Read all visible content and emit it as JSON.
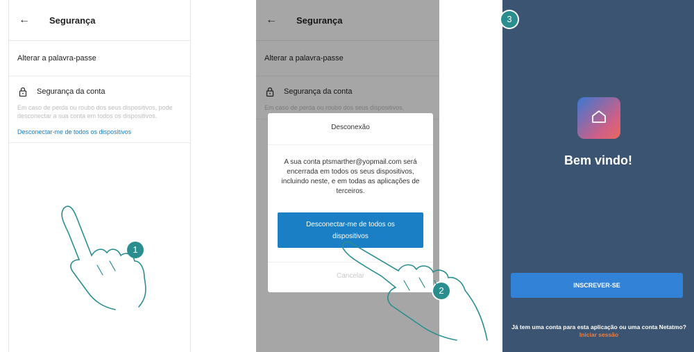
{
  "screen1": {
    "header": {
      "back_icon": "arrow-left-icon",
      "title": "Segurança"
    },
    "change_password": "Alterar a palavra-passe",
    "account_security": {
      "icon": "lock-icon",
      "title": "Segurança da conta",
      "description": "Em caso de perda ou roubo dos seus dispositivos, pode desconectar a sua conta em todos os dispositivos.",
      "link": "Desconectar-me de todos os dispositivos"
    },
    "step_badge": "1"
  },
  "screen2": {
    "header": {
      "back_icon": "arrow-left-icon",
      "title": "Segurança"
    },
    "change_password": "Alterar a palavra-passe",
    "account_security": {
      "icon": "lock-icon",
      "title": "Segurança da conta",
      "description": "Em caso de perda ou roubo dos seus dispositivos,"
    },
    "dialog": {
      "title": "Desconexão",
      "body": "A sua conta ptsmarther@yopmail.com será encerrada em todos os seus dispositivos, incluindo neste, e em todas as aplicações de terceiros.",
      "confirm_button": "Desconectar-me de todos os dispositivos",
      "cancel_button": "Cancelar"
    },
    "step_badge": "2"
  },
  "screen3": {
    "step_badge": "3",
    "logo_icon": "home-icon",
    "welcome": "Bem vindo!",
    "signup_button": "INSCREVER-SE",
    "footer_text": "Já tem uma conta para esta aplicação ou uma conta Netatmo?",
    "login_link": "Iniciar sessão",
    "colors": {
      "background": "#3b5472",
      "button": "#3282d8",
      "link": "#f47e3b"
    }
  }
}
